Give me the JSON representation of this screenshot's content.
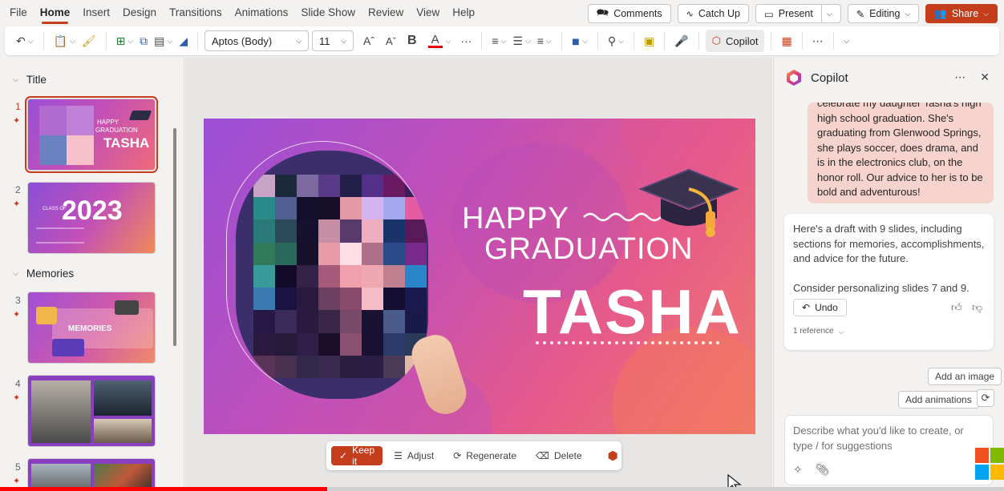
{
  "menu": {
    "tabs": [
      "File",
      "Home",
      "Insert",
      "Design",
      "Transitions",
      "Animations",
      "Slide Show",
      "Review",
      "View",
      "Help"
    ],
    "active_tab": "Home",
    "comments": "Comments",
    "catch_up": "Catch Up",
    "present": "Present",
    "editing": "Editing",
    "share": "Share"
  },
  "ribbon": {
    "font": "Aptos (Body)",
    "size": "11",
    "bold": "B",
    "font_color_letter": "A",
    "more": "···",
    "copilot": "Copilot",
    "accent_color": "#c43e1c"
  },
  "thumbs": {
    "sections": [
      "Title",
      "Memories"
    ],
    "slides": [
      {
        "num": "1",
        "title_small": "HAPPY",
        "title_small2": "GRADUATION",
        "title_big": "TASHA"
      },
      {
        "num": "2",
        "label": "CLASS OF",
        "year": "2023"
      },
      {
        "num": "3",
        "label": "MEMORIES"
      },
      {
        "num": "4"
      },
      {
        "num": "5"
      }
    ]
  },
  "slide": {
    "line1": "HAPPY",
    "line2": "GRADUATION",
    "name": "TASHA"
  },
  "slide_toolbar": {
    "keep": "Keep it",
    "adjust": "Adjust",
    "regenerate": "Regenerate",
    "delete": "Delete"
  },
  "copilot": {
    "title": "Copilot",
    "user_message": "celebrate my daughter Tasha's high high school graduation. She's graduating from Glenwood Springs, she plays soccer, does drama, and is in the electronics club, on the honor roll. Our advice to her is to be bold and adventurous!",
    "ai_message_1": "Here's a draft with 9 slides, including sections for memories, accomplishments, and advice for the future.",
    "ai_message_2": "Consider personalizing slides 7 and 9.",
    "undo": "Undo",
    "reference": "1 reference",
    "suggestions": [
      "Add an image",
      "Add animations"
    ],
    "placeholder": "Describe what you'd like to create, or type / for suggestions"
  },
  "video_progress": 0.326
}
